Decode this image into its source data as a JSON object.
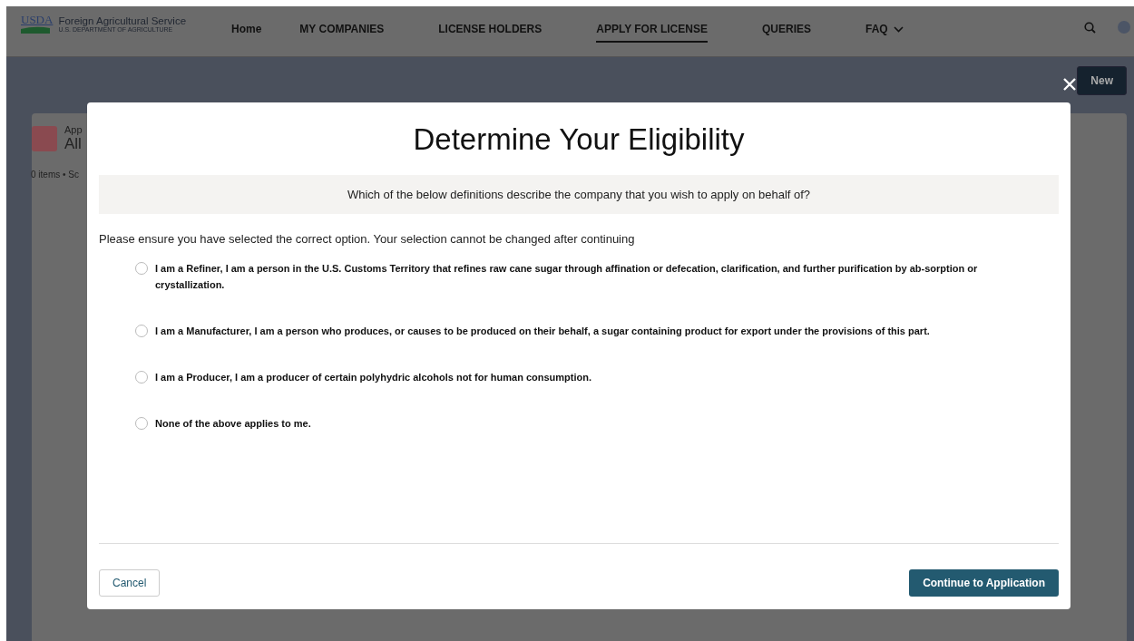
{
  "header": {
    "logo": {
      "mark": "USDA",
      "name": "Foreign Agricultural Service",
      "subtitle": "U.S. DEPARTMENT OF AGRICULTURE"
    },
    "nav": [
      {
        "label": "Home",
        "selected": false,
        "dropdown": false
      },
      {
        "label": "MY COMPANIES",
        "selected": false,
        "dropdown": false
      },
      {
        "label": "LICENSE HOLDERS",
        "selected": false,
        "dropdown": false
      },
      {
        "label": "APPLY FOR LICENSE",
        "selected": true,
        "dropdown": false
      },
      {
        "label": "QUERIES",
        "selected": false,
        "dropdown": false
      },
      {
        "label": "FAQ",
        "selected": false,
        "dropdown": true
      }
    ]
  },
  "background": {
    "new_button": "New",
    "list_label": "App",
    "list_title": "All",
    "item_count": "0 items • Sc"
  },
  "modal": {
    "title": "Determine Your Eligibility",
    "question": "Which of the below definitions describe the company that you wish to apply on behalf of?",
    "notice": "Please ensure you have selected the correct option. Your selection cannot be changed after continuing",
    "options": [
      {
        "label": "I am a Refiner, I am a person in the U.S. Customs Territory that refines raw cane sugar through affination or defecation, clarification, and further purification by ab-sorption or crystallization.",
        "selected": false
      },
      {
        "label": "I am a Manufacturer, I am a person who produces, or causes to be produced on their behalf, a sugar containing product for export under the provisions of this part.",
        "selected": false
      },
      {
        "label": "I am a Producer, I am a producer of certain polyhydric alcohols not for human consumption.",
        "selected": false
      },
      {
        "label": "None of the above applies to me.",
        "selected": false
      }
    ],
    "cancel": "Cancel",
    "continue": "Continue to Application"
  }
}
